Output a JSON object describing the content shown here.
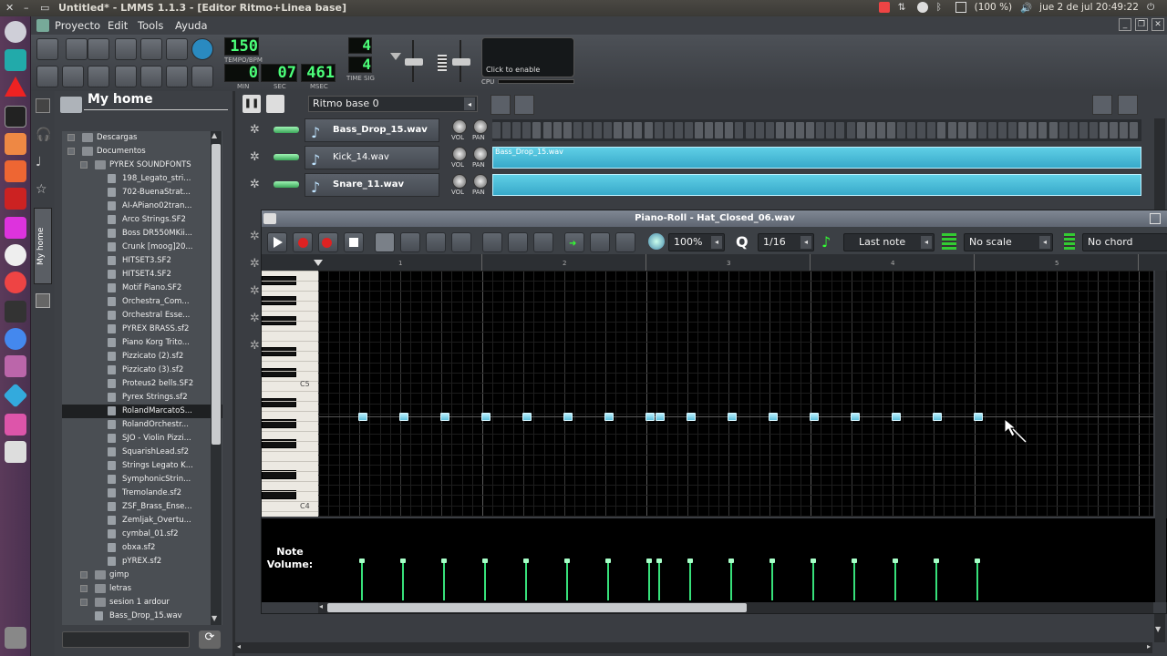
{
  "window": {
    "title": "Untitled* - LMMS 1.1.3 - [Editor Ritmo+Linea base]"
  },
  "system_tray": {
    "battery": "(100 %)",
    "datetime": "jue 2 de jul 20:49:22"
  },
  "menu": [
    "Proyecto",
    "Edit",
    "Tools",
    "Ayuda"
  ],
  "toolbar": {
    "tempo": "150",
    "tempo_label": "TEMPO/BPM",
    "min": "0",
    "sec": "07",
    "msec": "461",
    "min_label": "MIN",
    "sec_label": "SEC",
    "msec_label": "MSEC",
    "timesig_num": "4",
    "timesig_den": "4",
    "timesig_label": "TIME SIG",
    "cpu_text": "Click to enable",
    "cpu_label": "CPU"
  },
  "browser": {
    "title": "My home",
    "side_tab_label": "My home",
    "items": [
      {
        "label": "Descargas",
        "level": 0,
        "type": "folder"
      },
      {
        "label": "Documentos",
        "level": 0,
        "type": "folder"
      },
      {
        "label": "PYREX SOUNDFONTS",
        "level": 1,
        "type": "folder"
      },
      {
        "label": "198_Legato_stri...",
        "level": 2,
        "type": "file"
      },
      {
        "label": "702-BuenaStrat...",
        "level": 2,
        "type": "file"
      },
      {
        "label": "AI-APiano02tran...",
        "level": 2,
        "type": "file"
      },
      {
        "label": "Arco Strings.SF2",
        "level": 2,
        "type": "file"
      },
      {
        "label": "Boss DR550MKii...",
        "level": 2,
        "type": "file"
      },
      {
        "label": "Crunk [moog]20...",
        "level": 2,
        "type": "file"
      },
      {
        "label": "HITSET3.SF2",
        "level": 2,
        "type": "file"
      },
      {
        "label": "HITSET4.SF2",
        "level": 2,
        "type": "file"
      },
      {
        "label": "Motif Piano.SF2",
        "level": 2,
        "type": "file"
      },
      {
        "label": "Orchestra_Com...",
        "level": 2,
        "type": "file"
      },
      {
        "label": "Orchestral Esse...",
        "level": 2,
        "type": "file"
      },
      {
        "label": "PYREX BRASS.sf2",
        "level": 2,
        "type": "file"
      },
      {
        "label": "Piano Korg Trito...",
        "level": 2,
        "type": "file"
      },
      {
        "label": "Pizzicato (2).sf2",
        "level": 2,
        "type": "file"
      },
      {
        "label": "Pizzicato (3).sf2",
        "level": 2,
        "type": "file"
      },
      {
        "label": "Proteus2 bells.SF2",
        "level": 2,
        "type": "file"
      },
      {
        "label": "Pyrex Strings.sf2",
        "level": 2,
        "type": "file"
      },
      {
        "label": "RolandMarcatoS...",
        "level": 2,
        "type": "file",
        "selected": true
      },
      {
        "label": "RolandOrchestr...",
        "level": 2,
        "type": "file"
      },
      {
        "label": "SJO - Violin Pizzi...",
        "level": 2,
        "type": "file"
      },
      {
        "label": "SquarishLead.sf2",
        "level": 2,
        "type": "file"
      },
      {
        "label": "Strings Legato K...",
        "level": 2,
        "type": "file"
      },
      {
        "label": "SymphonicStrin...",
        "level": 2,
        "type": "file"
      },
      {
        "label": "Tremolande.sf2",
        "level": 2,
        "type": "file"
      },
      {
        "label": "ZSF_Brass_Ense...",
        "level": 2,
        "type": "file"
      },
      {
        "label": "Zemljak_Overtu...",
        "level": 2,
        "type": "file"
      },
      {
        "label": "cymbal_01.sf2",
        "level": 2,
        "type": "file"
      },
      {
        "label": "obxa.sf2",
        "level": 2,
        "type": "file"
      },
      {
        "label": "pYREX.sf2",
        "level": 2,
        "type": "file"
      },
      {
        "label": "gimp",
        "level": 1,
        "type": "folder"
      },
      {
        "label": "letras",
        "level": 1,
        "type": "folder"
      },
      {
        "label": "sesion 1 ardour",
        "level": 1,
        "type": "folder"
      },
      {
        "label": "Bass_Drop_15.wav",
        "level": 1,
        "type": "wav"
      }
    ]
  },
  "song_editor": {
    "beat_selector": "Ritmo base 0",
    "tracks": [
      {
        "name": "Bass_Drop_15.wav",
        "bold": true,
        "clip_label": "",
        "vol": "VOL",
        "pan": "PAN"
      },
      {
        "name": "Kick_14.wav",
        "bold": false,
        "clip_label": "Bass_Drop_15.wav",
        "vol": "VOL",
        "pan": "PAN"
      },
      {
        "name": "Snare_11.wav",
        "bold": true,
        "clip_label": "",
        "vol": "VOL",
        "pan": "PAN"
      }
    ]
  },
  "piano_roll": {
    "title": "Piano-Roll - Hat_Closed_06.wav",
    "zoom": "100%",
    "quantize": "1/16",
    "note_length": "Last note",
    "scale": "No scale",
    "chord": "No chord",
    "ruler": [
      "1",
      "2",
      "3",
      "4",
      "5"
    ],
    "key_labels": [
      "C5",
      "C4"
    ],
    "volume_label": "Note Volume:",
    "notes_steps": [
      0,
      1,
      2,
      3,
      4,
      5,
      6,
      7,
      7.25,
      8,
      9,
      10,
      11,
      12,
      13,
      14,
      15
    ],
    "note_volume_percent": [
      100,
      100,
      100,
      100,
      100,
      100,
      100,
      100,
      100,
      100,
      100,
      100,
      100,
      100,
      100,
      100,
      100
    ]
  },
  "colors": {
    "note": "#7fd6ee",
    "volume": "#37e07a",
    "lcd": "#4cff7a",
    "launcher": "#5b3a5a"
  }
}
